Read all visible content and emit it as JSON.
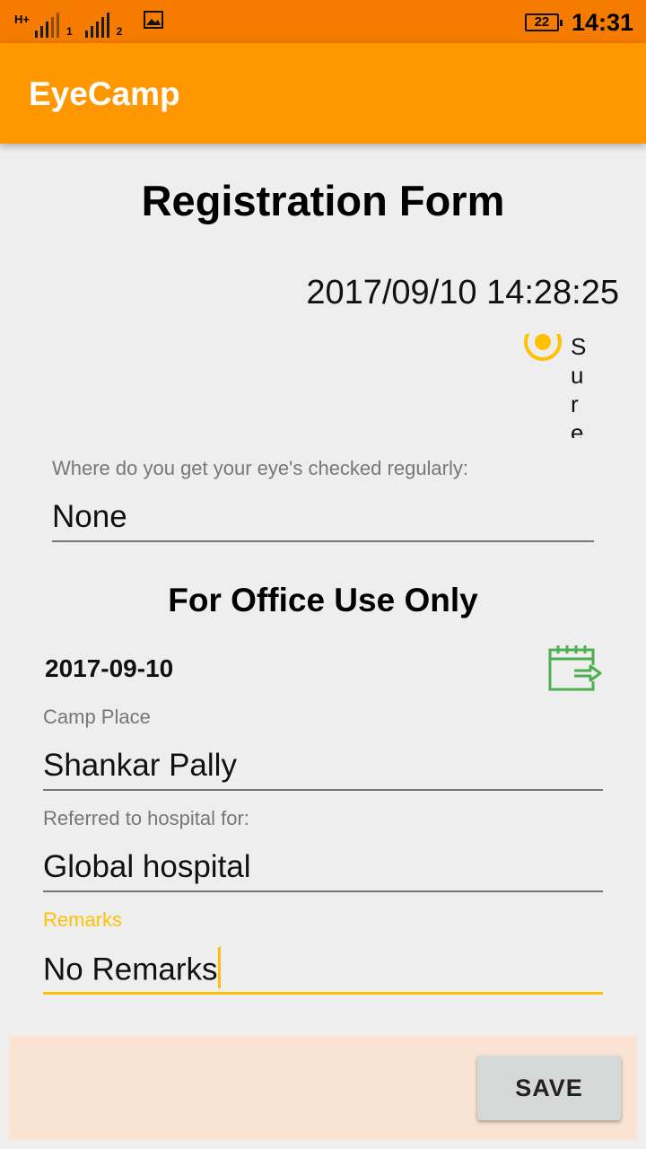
{
  "status_bar": {
    "network_label": "H+",
    "sim1": "1",
    "sim2": "2",
    "battery": "22",
    "time": "14:31",
    "icons": [
      "signal-icon",
      "image-icon",
      "battery-icon"
    ]
  },
  "app_bar": {
    "title": "EyeCamp",
    "color": "#ff9800"
  },
  "form": {
    "title": "Registration Form",
    "datetime": "2017/09/10 14:28:25",
    "radio_option_label": "Sure",
    "eye_check_label": "Where do you get your eye's checked regularly:",
    "eye_check_value": "None"
  },
  "office": {
    "section_title": "For Office Use Only",
    "date": "2017-09-10",
    "camp_place_label": "Camp Place",
    "camp_place_value": "Shankar Pally",
    "referred_label": "Referred to hospital for:",
    "referred_value": "Global hospital",
    "remarks_label": "Remarks",
    "remarks_value": "No Remarks"
  },
  "actions": {
    "save_label": "SAVE"
  },
  "colors": {
    "accent": "#ffc107",
    "status_bar": "#f57c00",
    "bottom_bar": "#fbe3d4",
    "icon_green": "#4caf50"
  }
}
